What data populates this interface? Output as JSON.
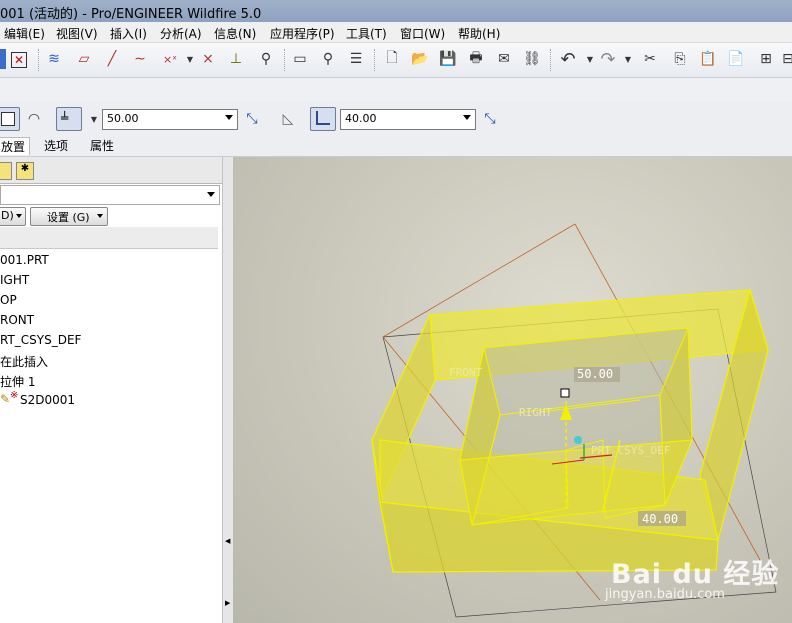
{
  "window": {
    "title": "001 (活动的) - Pro/ENGINEER Wildfire 5.0"
  },
  "menubar": [
    "编辑(E)",
    "视图(V)",
    "插入(I)",
    "分析(A)",
    "信息(N)",
    "应用程序(P)",
    "工具(T)",
    "窗口(W)",
    "帮助(H)"
  ],
  "dashboard": {
    "depth1_value": "50.00",
    "depth2_value": "40.00"
  },
  "tabs": [
    "放置",
    "选项",
    "属性"
  ],
  "model_tree": {
    "filter_label": "D)",
    "settings_button": "设置 (G)",
    "items": [
      "001.PRT",
      "IGHT",
      "OP",
      "RONT",
      "RT_CSYS_DEF",
      "在此插入",
      "拉伸 1",
      "S2D0001"
    ]
  },
  "viewport": {
    "labels": {
      "front": "FRONT",
      "right": "RIGHT",
      "csys": "PRT_CSYS_DEF",
      "dim1": "50.00",
      "dim2": "40.00"
    },
    "watermark": {
      "brand": "Bai du 经验",
      "url": "jingyan.baidu.com"
    },
    "colors": {
      "solid_fill": "#e8e02a",
      "edge": "#f3f000",
      "datum_plane": "#c0652c"
    }
  }
}
